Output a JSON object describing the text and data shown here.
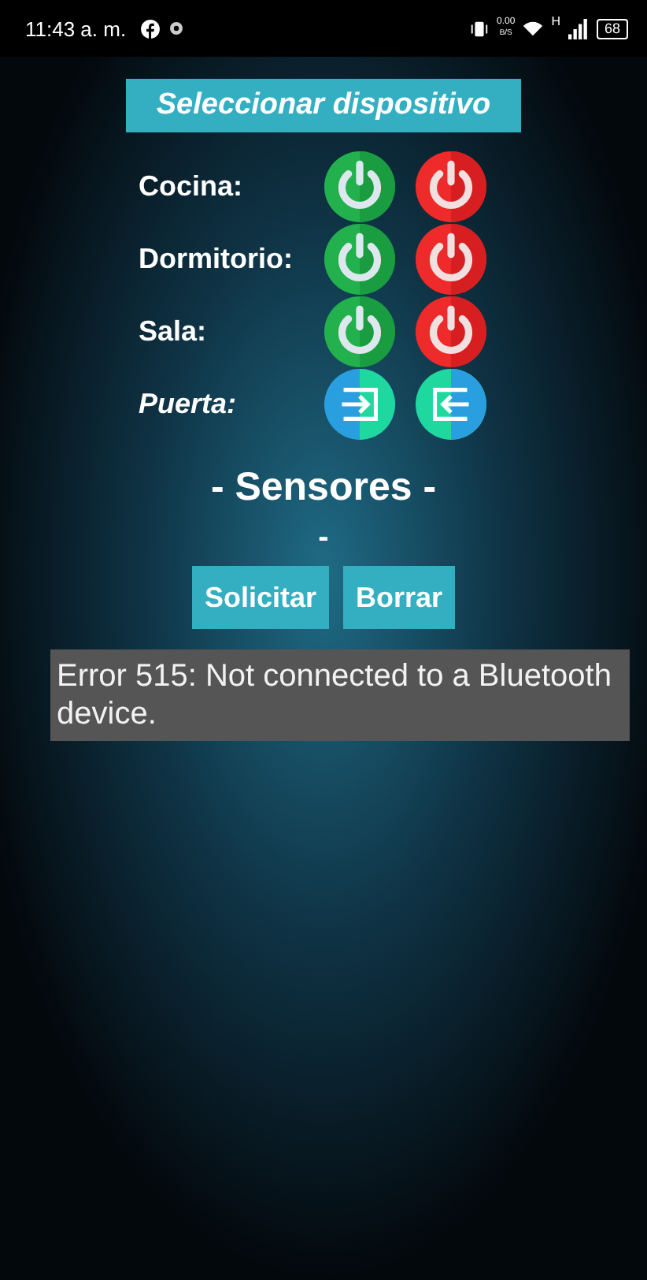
{
  "status_bar": {
    "time": "11:43 a. m.",
    "speed_value": "0.00",
    "speed_unit": "B/S",
    "network_type": "H",
    "battery": "68"
  },
  "select_button": "Seleccionar dispositivo",
  "devices": [
    {
      "name": "Cocina:",
      "kind": "switch"
    },
    {
      "name": "Dormitorio:",
      "kind": "switch"
    },
    {
      "name": "Sala:",
      "kind": "switch"
    },
    {
      "name": "Puerta:",
      "kind": "door"
    }
  ],
  "sensors_title": "- Sensores -",
  "sensor_value": "-",
  "actions": [
    "Solicitar",
    "Borrar"
  ],
  "error_message": "Error 515: Not connected to a Bluetooth device."
}
